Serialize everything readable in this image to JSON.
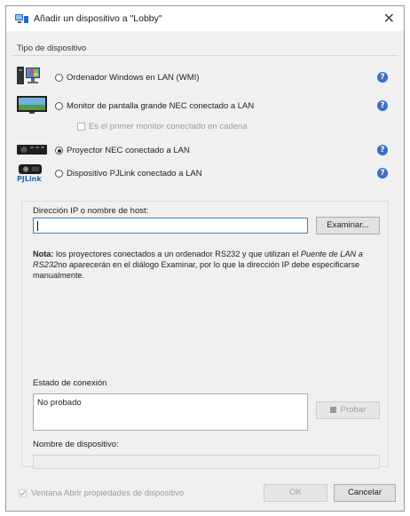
{
  "window": {
    "title": "Añadir un dispositivo a \"Lobby\"",
    "close_icon": "close-icon"
  },
  "device_type": {
    "group_label": "Tipo de dispositivo",
    "options": [
      {
        "label": "Ordenador Windows en LAN (WMI)",
        "icon": "computer-icon",
        "selected": false
      },
      {
        "label": "Monitor de pantalla grande NEC conectado a LAN",
        "icon": "monitor-icon",
        "selected": false
      },
      {
        "label": "Proyector NEC conectado a LAN",
        "icon": "projector-icon",
        "selected": true
      },
      {
        "label": "Dispositivo PJLink conectado a LAN",
        "icon": "pjlink-icon",
        "selected": false
      }
    ],
    "chain_checkbox_label": "Es el primer monitor conectado en cadena",
    "pjlink_logo_text": "PJLink",
    "help_glyph": "?"
  },
  "connection": {
    "ip_label": "Dirección IP o nombre de host:",
    "ip_value": "",
    "browse_button": "Examinar...",
    "note_bold": "Nota:",
    "note_text_1": " los proyectores conectados a un ordenador RS232 y que utilizan el ",
    "note_italic": "Puente de LAN a RS232",
    "note_text_2": "no aparecerán en el diálogo Examinar, por lo que la dirección IP debe especificarse manualmente.",
    "status_label": "Estado de conexión",
    "status_value": "No probado",
    "test_button": "Probar",
    "device_name_label": "Nombre de dispositivo:",
    "device_name_value": ""
  },
  "footer": {
    "open_props_label": "Ventana Abrir propiedades de dispositivo",
    "ok_button": "OK",
    "cancel_button": "Cancelar"
  },
  "colors": {
    "accent": "#3c7fd1",
    "help": "#3d6fc8"
  }
}
